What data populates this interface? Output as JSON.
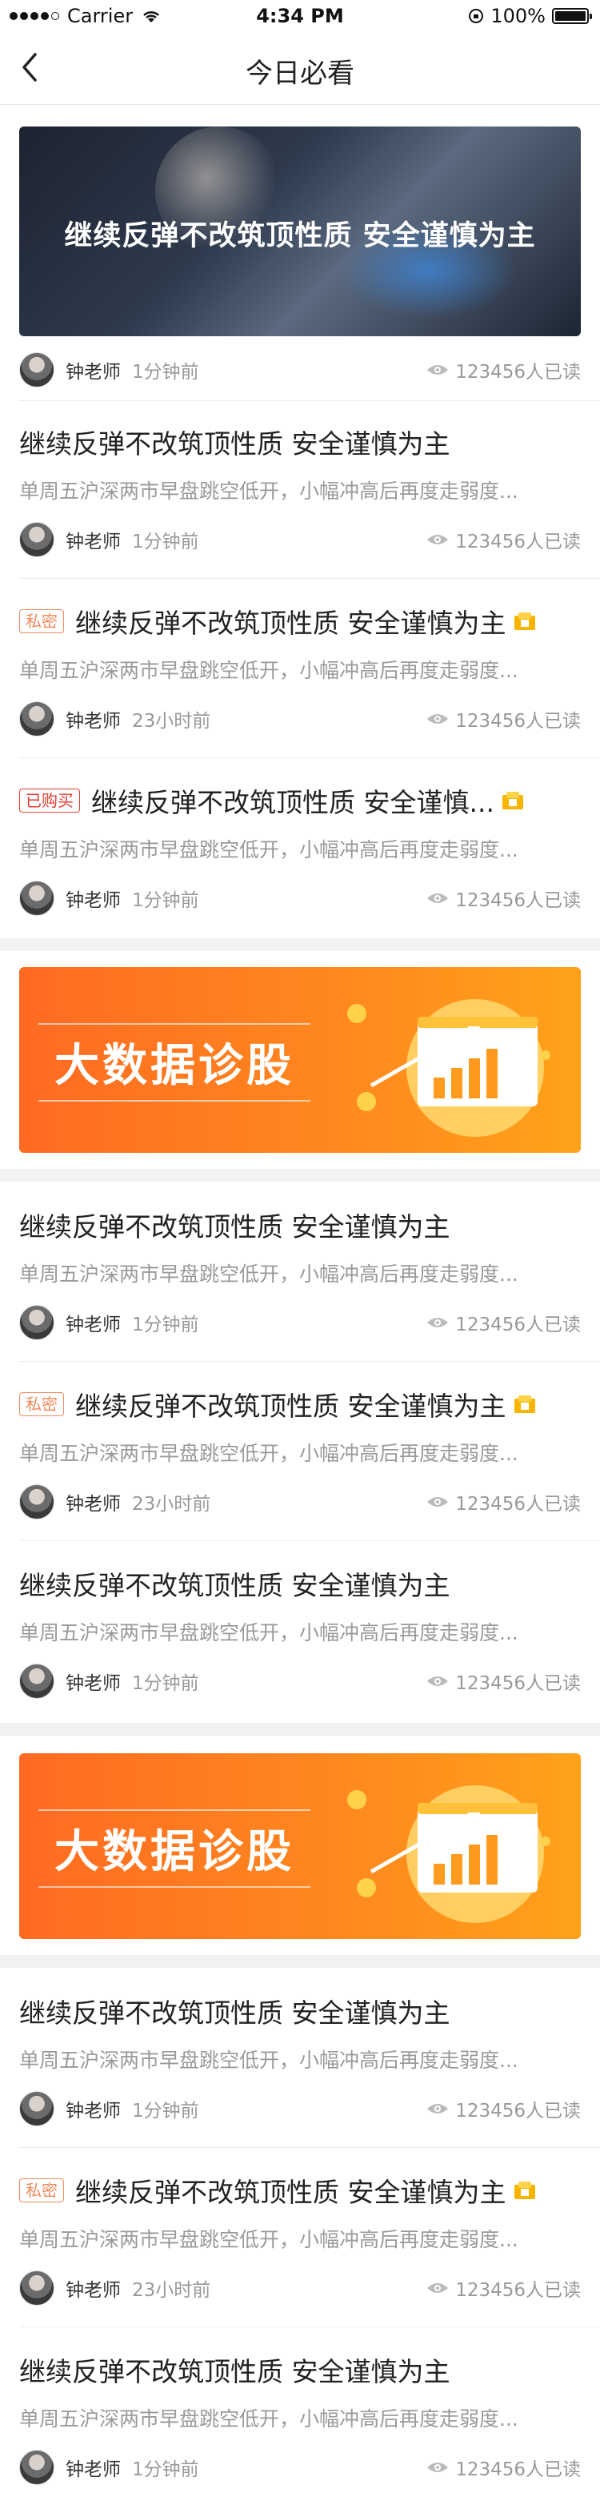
{
  "status_bar": {
    "carrier": "Carrier",
    "time": "4:34 PM",
    "battery": "100%"
  },
  "nav": {
    "title": "今日必看"
  },
  "hero": {
    "title": "继续反弹不改筑顶性质 安全谨慎为主"
  },
  "hero_meta": {
    "author": "钟老师",
    "time": "1分钟前",
    "reads": "123456人已读"
  },
  "articles_group1": [
    {
      "tag": "",
      "title": "继续反弹不改筑顶性质 安全谨慎为主",
      "summary": "单周五沪深两市早盘跳空低开，小幅冲高后再度走弱度...",
      "author": "钟老师",
      "time": "1分钟前",
      "reads": "123456人已读",
      "coin": false
    },
    {
      "tag": "私密",
      "title": "继续反弹不改筑顶性质 安全谨慎为主",
      "summary": "单周五沪深两市早盘跳空低开，小幅冲高后再度走弱度...",
      "author": "钟老师",
      "time": "23小时前",
      "reads": "123456人已读",
      "coin": true
    },
    {
      "tag": "已购买",
      "title": "继续反弹不改筑顶性质 安全谨慎...",
      "summary": "单周五沪深两市早盘跳空低开，小幅冲高后再度走弱度...",
      "author": "钟老师",
      "time": "1分钟前",
      "reads": "123456人已读",
      "coin": true
    }
  ],
  "banner1": {
    "text": "大数据诊股"
  },
  "articles_group2": [
    {
      "tag": "",
      "title": "继续反弹不改筑顶性质 安全谨慎为主",
      "summary": "单周五沪深两市早盘跳空低开，小幅冲高后再度走弱度...",
      "author": "钟老师",
      "time": "1分钟前",
      "reads": "123456人已读",
      "coin": false
    },
    {
      "tag": "私密",
      "title": "继续反弹不改筑顶性质 安全谨慎为主",
      "summary": "单周五沪深两市早盘跳空低开，小幅冲高后再度走弱度...",
      "author": "钟老师",
      "time": "23小时前",
      "reads": "123456人已读",
      "coin": true
    },
    {
      "tag": "",
      "title": "继续反弹不改筑顶性质 安全谨慎为主",
      "summary": "单周五沪深两市早盘跳空低开，小幅冲高后再度走弱度...",
      "author": "钟老师",
      "time": "1分钟前",
      "reads": "123456人已读",
      "coin": false
    }
  ],
  "banner2": {
    "text": "大数据诊股"
  },
  "articles_group3": [
    {
      "tag": "",
      "title": "继续反弹不改筑顶性质 安全谨慎为主",
      "summary": "单周五沪深两市早盘跳空低开，小幅冲高后再度走弱度...",
      "author": "钟老师",
      "time": "1分钟前",
      "reads": "123456人已读",
      "coin": false
    },
    {
      "tag": "私密",
      "title": "继续反弹不改筑顶性质 安全谨慎为主",
      "summary": "单周五沪深两市早盘跳空低开，小幅冲高后再度走弱度...",
      "author": "钟老师",
      "time": "23小时前",
      "reads": "123456人已读",
      "coin": true
    },
    {
      "tag": "",
      "title": "继续反弹不改筑顶性质 安全谨慎为主",
      "summary": "单周五沪深两市早盘跳空低开，小幅冲高后再度走弱度...",
      "author": "钟老师",
      "time": "1分钟前",
      "reads": "123456人已读",
      "coin": false
    }
  ],
  "colors": {
    "accent": "#ff7a1f",
    "private_tag": "#f08a5d",
    "bought_tag": "#e03a2e",
    "coin": "#f7b500"
  }
}
